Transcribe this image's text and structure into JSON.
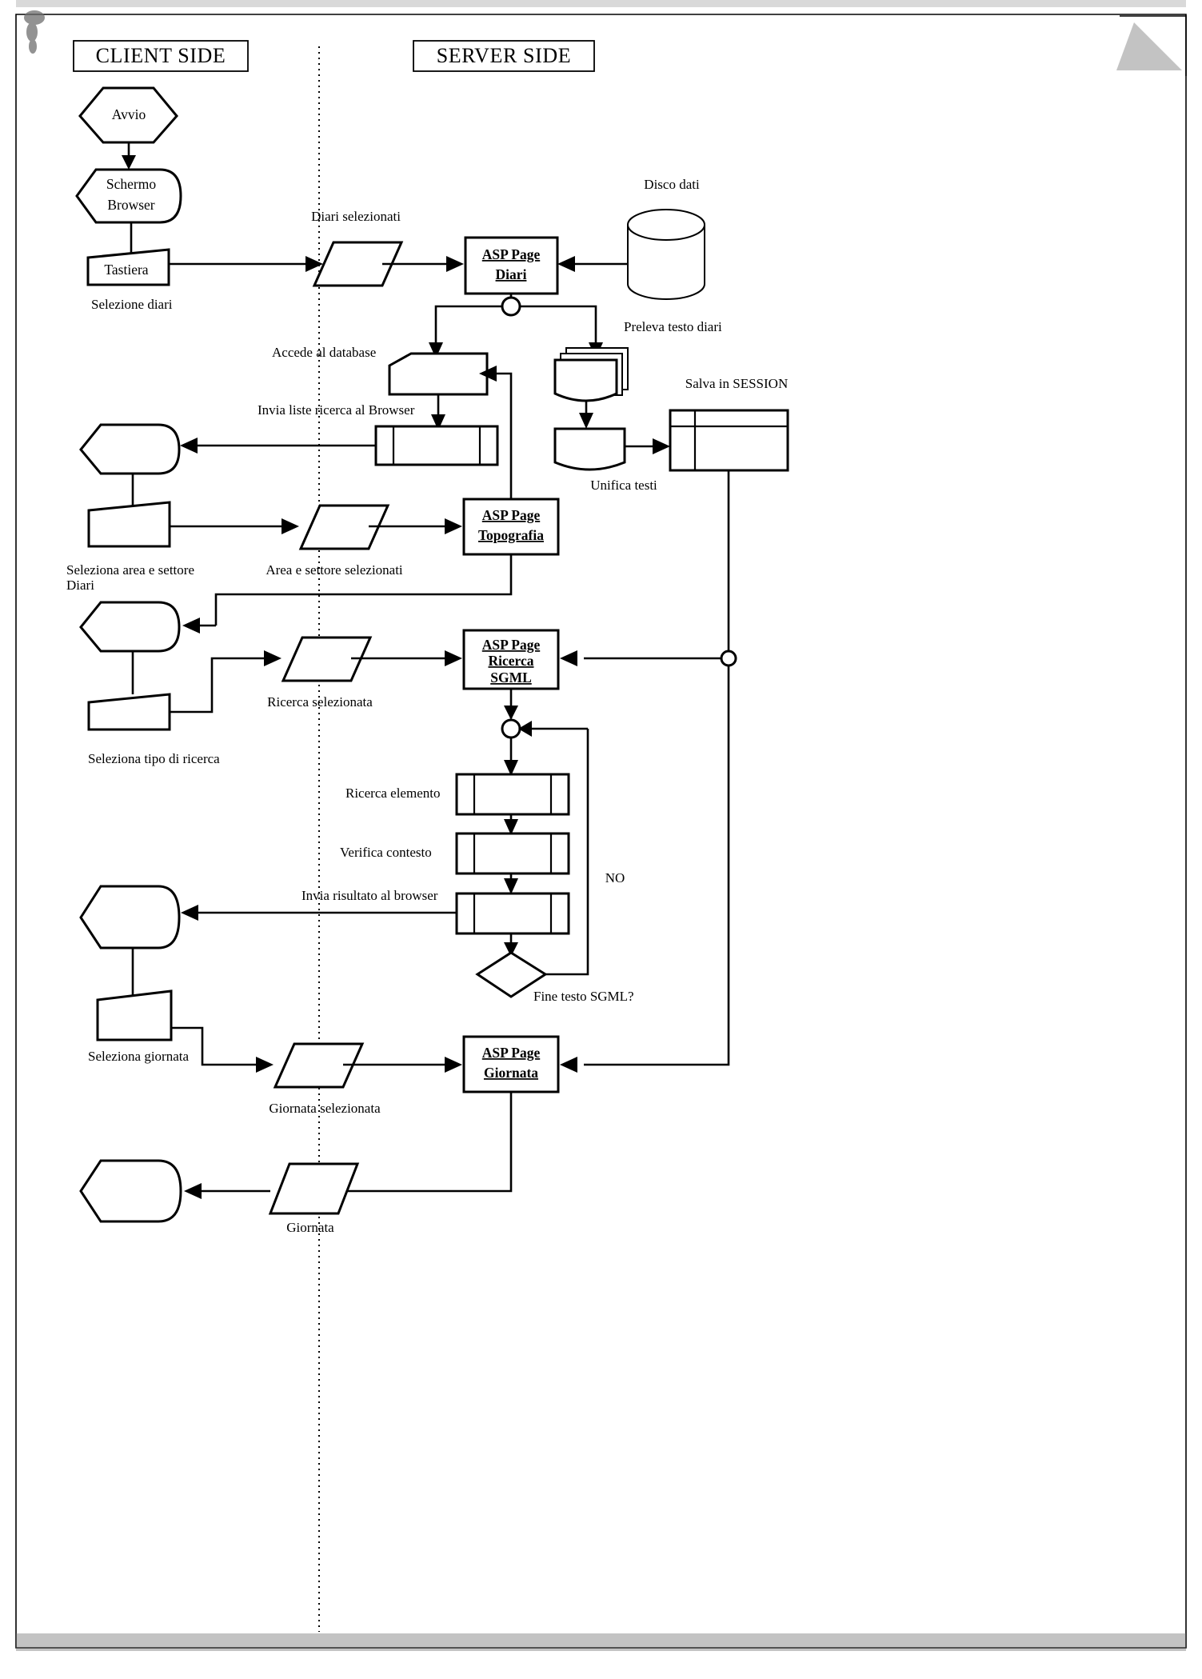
{
  "diagram": {
    "title_left": "CLIENT SIDE",
    "title_right": "SERVER SIDE",
    "language": "it",
    "type": "flowchart",
    "lane_divider": "dotted-vertical"
  },
  "nodes": {
    "avvio": "Avvio",
    "schermo_browser_line1": "Schermo",
    "schermo_browser_line2": "Browser",
    "tastiera": "Tastiera",
    "asp_diari_line1": "ASP Page",
    "asp_diari_line2": "Diari",
    "asp_topografia_line1": "ASP Page",
    "asp_topografia_line2": "Topografia",
    "asp_ricerca_line1": "ASP Page",
    "asp_ricerca_line2": "Ricerca",
    "asp_ricerca_line3": "SGML",
    "asp_giornata_line1": "ASP Page",
    "asp_giornata_line2": "Giornata"
  },
  "labels": {
    "disco_dati": "Disco dati",
    "diari_selezionati": "Diari selezionati",
    "selezione_diari": "Selezione diari",
    "preleva_testo_diari": "Preleva testo diari",
    "accede_al_database": "Accede al database",
    "invia_liste_ricerca": "Invia liste ricerca al Browser",
    "salva_in_session": "Salva in SESSION",
    "unifica_testi": "Unifica testi",
    "area_settore_selezionati": "Area e settore selezionati",
    "seleziona_area_settore_line1": "Seleziona   area   e   settore",
    "seleziona_area_settore_line2": "Diari",
    "ricerca_selezionata": "Ricerca selezionata",
    "seleziona_tipo_ricerca": "Seleziona tipo di ricerca",
    "ricerca_elemento": "Ricerca elemento",
    "verifica_contesto": "Verifica contesto",
    "invia_risultato_browser": "Invia risultato al browser",
    "no": "NO",
    "fine_testo_sgml": "Fine testo SGML?",
    "seleziona_giornata": "Seleziona giornata",
    "giornata_selezionata": "Giornata selezionata",
    "giornata": "Giornata"
  },
  "colors": {
    "stroke": "#000000",
    "fill": "#ffffff",
    "noise": "#6e6e6e"
  }
}
